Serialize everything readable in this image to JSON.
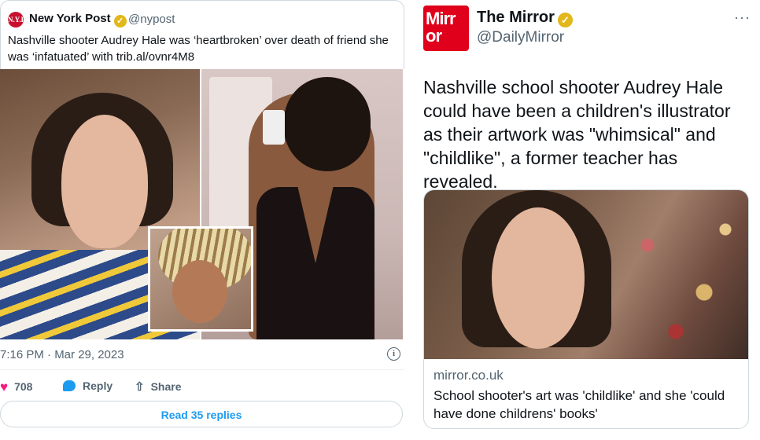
{
  "left_tweet": {
    "author": "New York Post",
    "avatar_text": "N.Y.P",
    "handle": "@nypost",
    "text": "Nashville shooter Audrey Hale was ‘heartbroken’ over death of friend she was ‘infatuated’ with trib.al/ovnr4M8",
    "timestamp": "7:16 PM · Mar 29, 2023",
    "info_icon": "i",
    "likes": "708",
    "reply_label": "Reply",
    "share_label": "Share",
    "read_replies": "Read 35 replies",
    "verified_color": "#e2b719"
  },
  "right_tweet": {
    "author": "The Mirror",
    "logo_line1": "Mirr",
    "logo_line2": "or",
    "handle": "@DailyMirror",
    "more": "···",
    "text": "Nashville school shooter Audrey Hale could have been a children's illustrator as their artwork was \"whimsical\" and \"childlike\", a former teacher has revealed.",
    "link_domain": "mirror.co.uk",
    "link_title": "School shooter's art was 'childlike' and she 'could have done childrens' books'",
    "brand_color": "#e0001b"
  },
  "icons": {
    "verified": "✓",
    "heart": "♥",
    "share": "⇧"
  }
}
